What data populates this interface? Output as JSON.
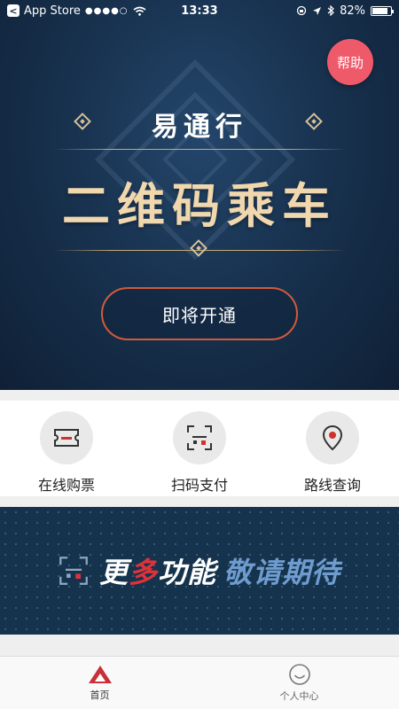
{
  "status_bar": {
    "carrier": "App Store",
    "signal": "●●●●○",
    "time": "13:33",
    "battery": "82%"
  },
  "hero": {
    "help_label": "帮助",
    "brand": "易通行",
    "headline": "二维码乘车",
    "button_label": "即将开通"
  },
  "actions": [
    {
      "label": "在线购票",
      "icon": "ticket-icon"
    },
    {
      "label": "扫码支付",
      "icon": "scan-icon"
    },
    {
      "label": "路线查询",
      "icon": "location-pin-icon"
    }
  ],
  "banner": {
    "part1": "更",
    "part2": "多",
    "part3": "功能",
    "part4": "敬请期待"
  },
  "tabs": [
    {
      "label": "首页",
      "icon": "home-icon",
      "active": true
    },
    {
      "label": "个人中心",
      "icon": "smile-icon",
      "active": false
    }
  ],
  "colors": {
    "hero_bg": "#18324f",
    "gold": "#f0d7ad",
    "accent_red": "#e0323a",
    "help_pink": "#ef5a6a",
    "button_border": "#d25a3a"
  }
}
